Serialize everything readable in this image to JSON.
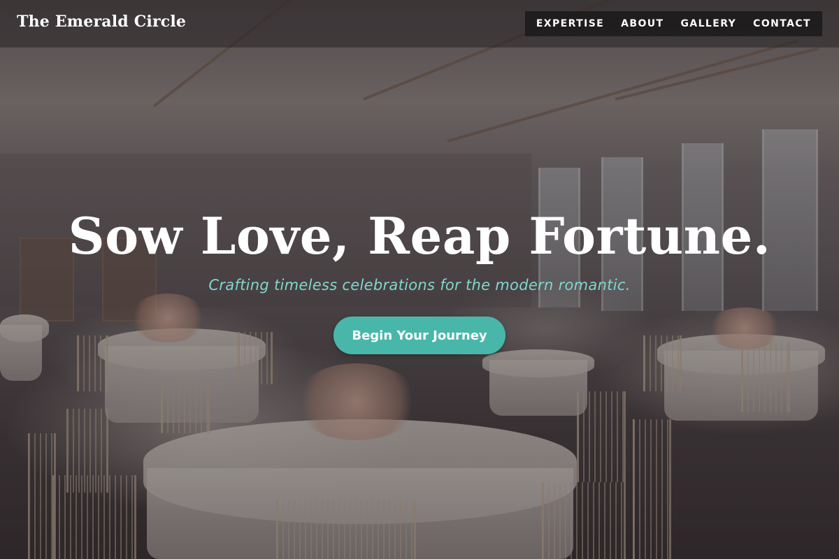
{
  "header": {
    "brand": "The Emerald Circle",
    "nav": [
      {
        "label": "EXPERTISE"
      },
      {
        "label": "ABOUT"
      },
      {
        "label": "GALLERY"
      },
      {
        "label": "CONTACT"
      }
    ]
  },
  "hero": {
    "headline": "Sow Love, Reap Fortune.",
    "tagline": "Crafting timeless celebrations for the modern romantic.",
    "cta_label": "Begin Your Journey"
  },
  "colors": {
    "accent": "#48b7aa",
    "tagline": "#7fd7cf",
    "header_bg": "#282426",
    "nav_bg": "#141214"
  }
}
